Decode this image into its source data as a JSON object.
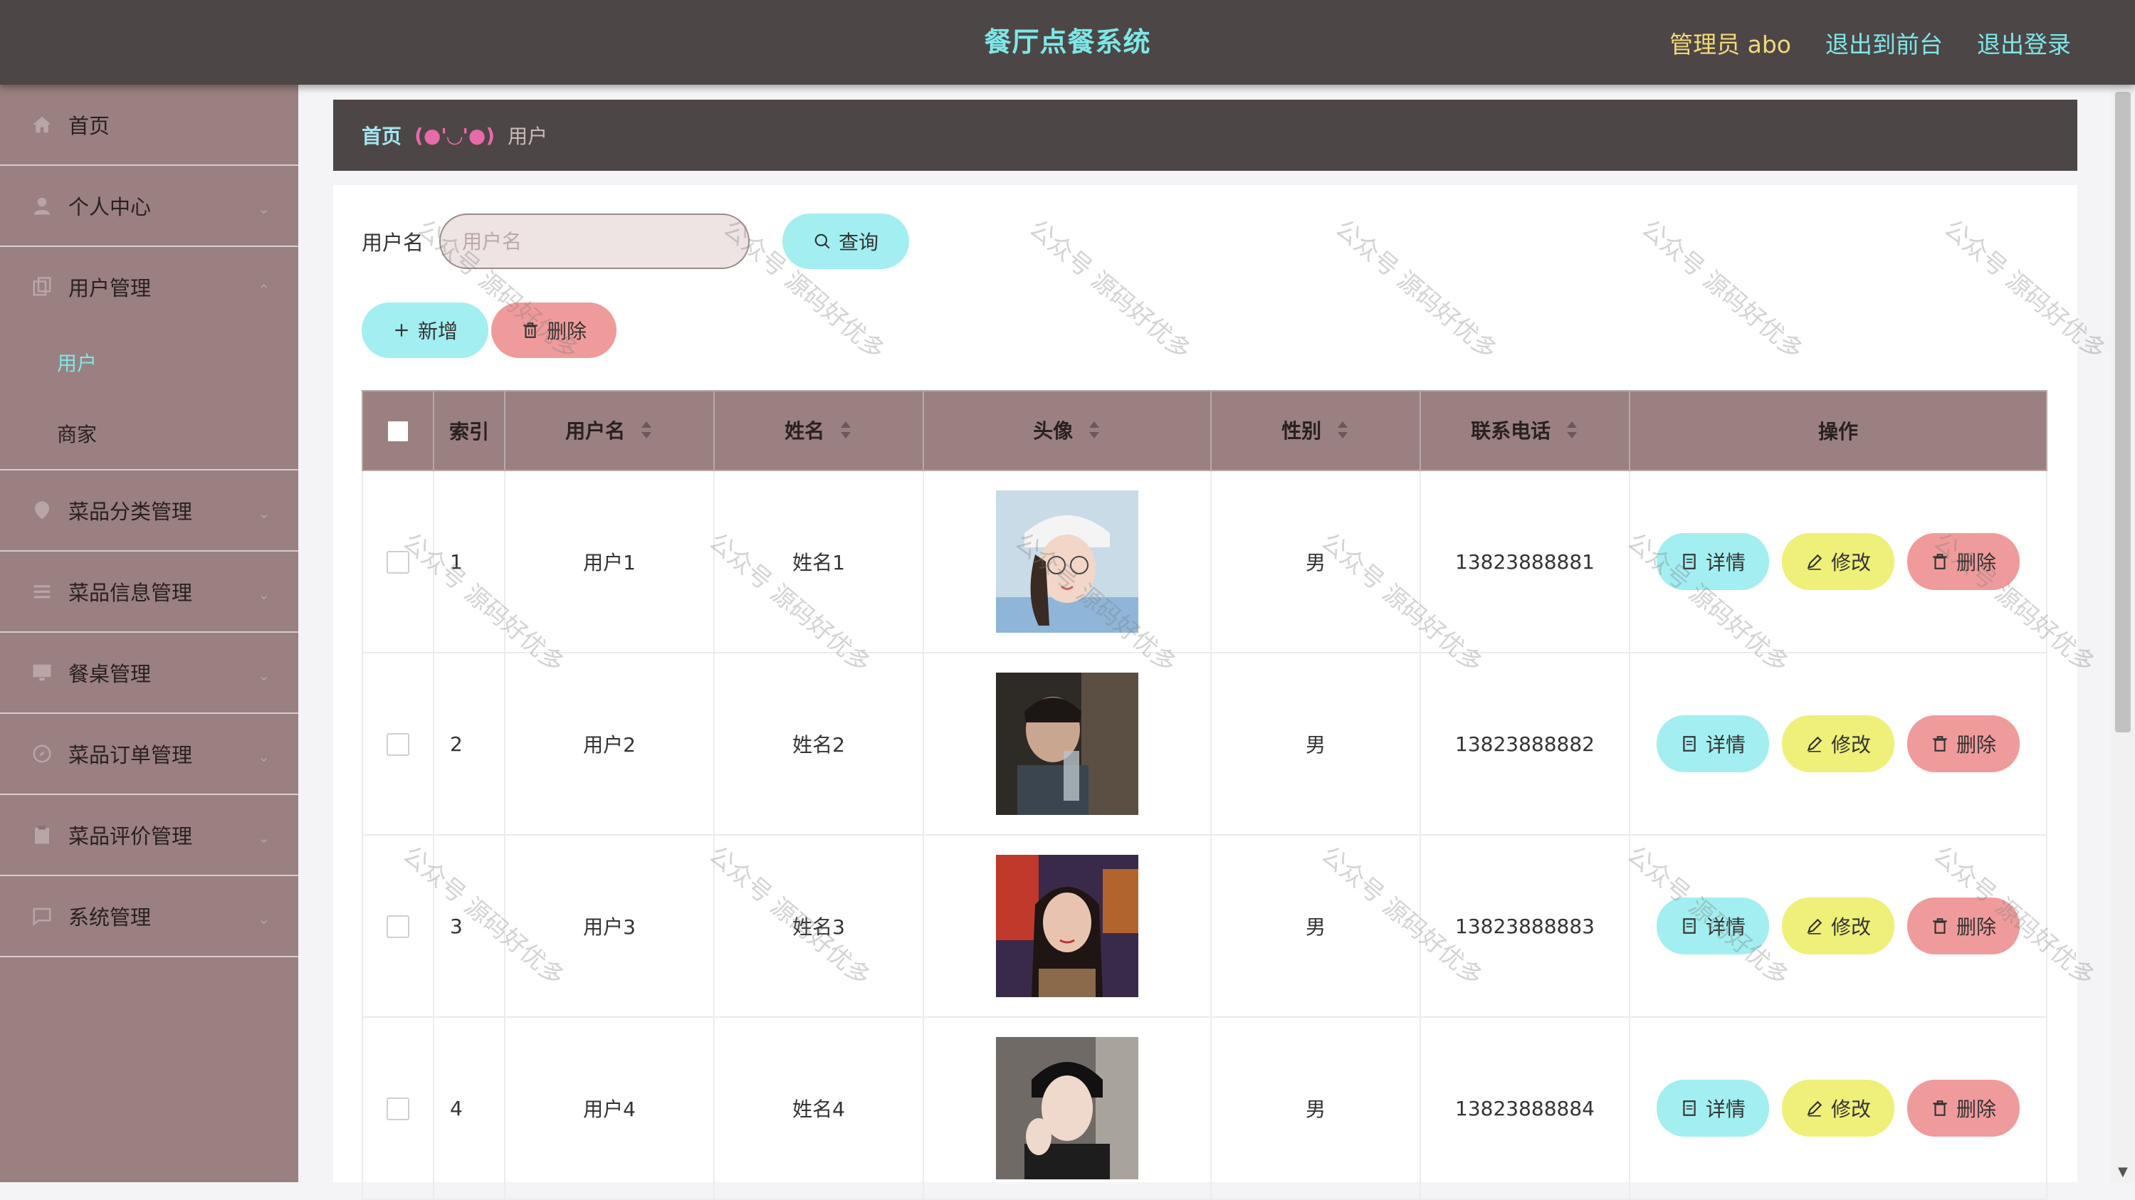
{
  "header": {
    "title": "餐厅点餐系统",
    "admin_label": "管理员 abo",
    "to_frontend": "退出到前台",
    "logout": "退出登录"
  },
  "sidebar": {
    "items": [
      {
        "label": "首页",
        "icon": "home-icon"
      },
      {
        "label": "个人中心",
        "icon": "person-icon"
      },
      {
        "label": "用户管理",
        "icon": "copy-icon"
      },
      {
        "label": "菜品分类管理",
        "icon": "location-icon"
      },
      {
        "label": "菜品信息管理",
        "icon": "list-icon"
      },
      {
        "label": "餐桌管理",
        "icon": "monitor-icon"
      },
      {
        "label": "菜品订单管理",
        "icon": "compass-icon"
      },
      {
        "label": "菜品评价管理",
        "icon": "clipboard-icon"
      },
      {
        "label": "系统管理",
        "icon": "message-icon"
      }
    ],
    "submenu": [
      "用户",
      "商家"
    ]
  },
  "breadcrumb": {
    "home": "首页",
    "separator": "(●'◡'●)",
    "current": "用户"
  },
  "search": {
    "label": "用户名",
    "placeholder": "用户名",
    "query_button": "查询"
  },
  "actions": {
    "add": "新增",
    "delete": "删除"
  },
  "table": {
    "headers": [
      "索引",
      "用户名",
      "姓名",
      "头像",
      "性别",
      "联系电话",
      "操作"
    ],
    "row_actions": {
      "detail": "详情",
      "edit": "修改",
      "delete": "删除"
    },
    "rows": [
      {
        "index": "1",
        "username": "用户1",
        "name": "姓名1",
        "gender": "男",
        "phone": "13823888881"
      },
      {
        "index": "2",
        "username": "用户2",
        "name": "姓名2",
        "gender": "男",
        "phone": "13823888882"
      },
      {
        "index": "3",
        "username": "用户3",
        "name": "姓名3",
        "gender": "男",
        "phone": "13823888883"
      },
      {
        "index": "4",
        "username": "用户4",
        "name": "姓名4",
        "gender": "男",
        "phone": "13823888884"
      }
    ]
  },
  "watermark": "公众号 源码好优多",
  "colors": {
    "topbar": "#4d4646",
    "sidebar": "#9a8080",
    "accent_cyan": "#7ee7e7",
    "button_cyan": "#a3eef0",
    "button_red": "#f09b9b",
    "button_yellow": "#eef07a"
  }
}
